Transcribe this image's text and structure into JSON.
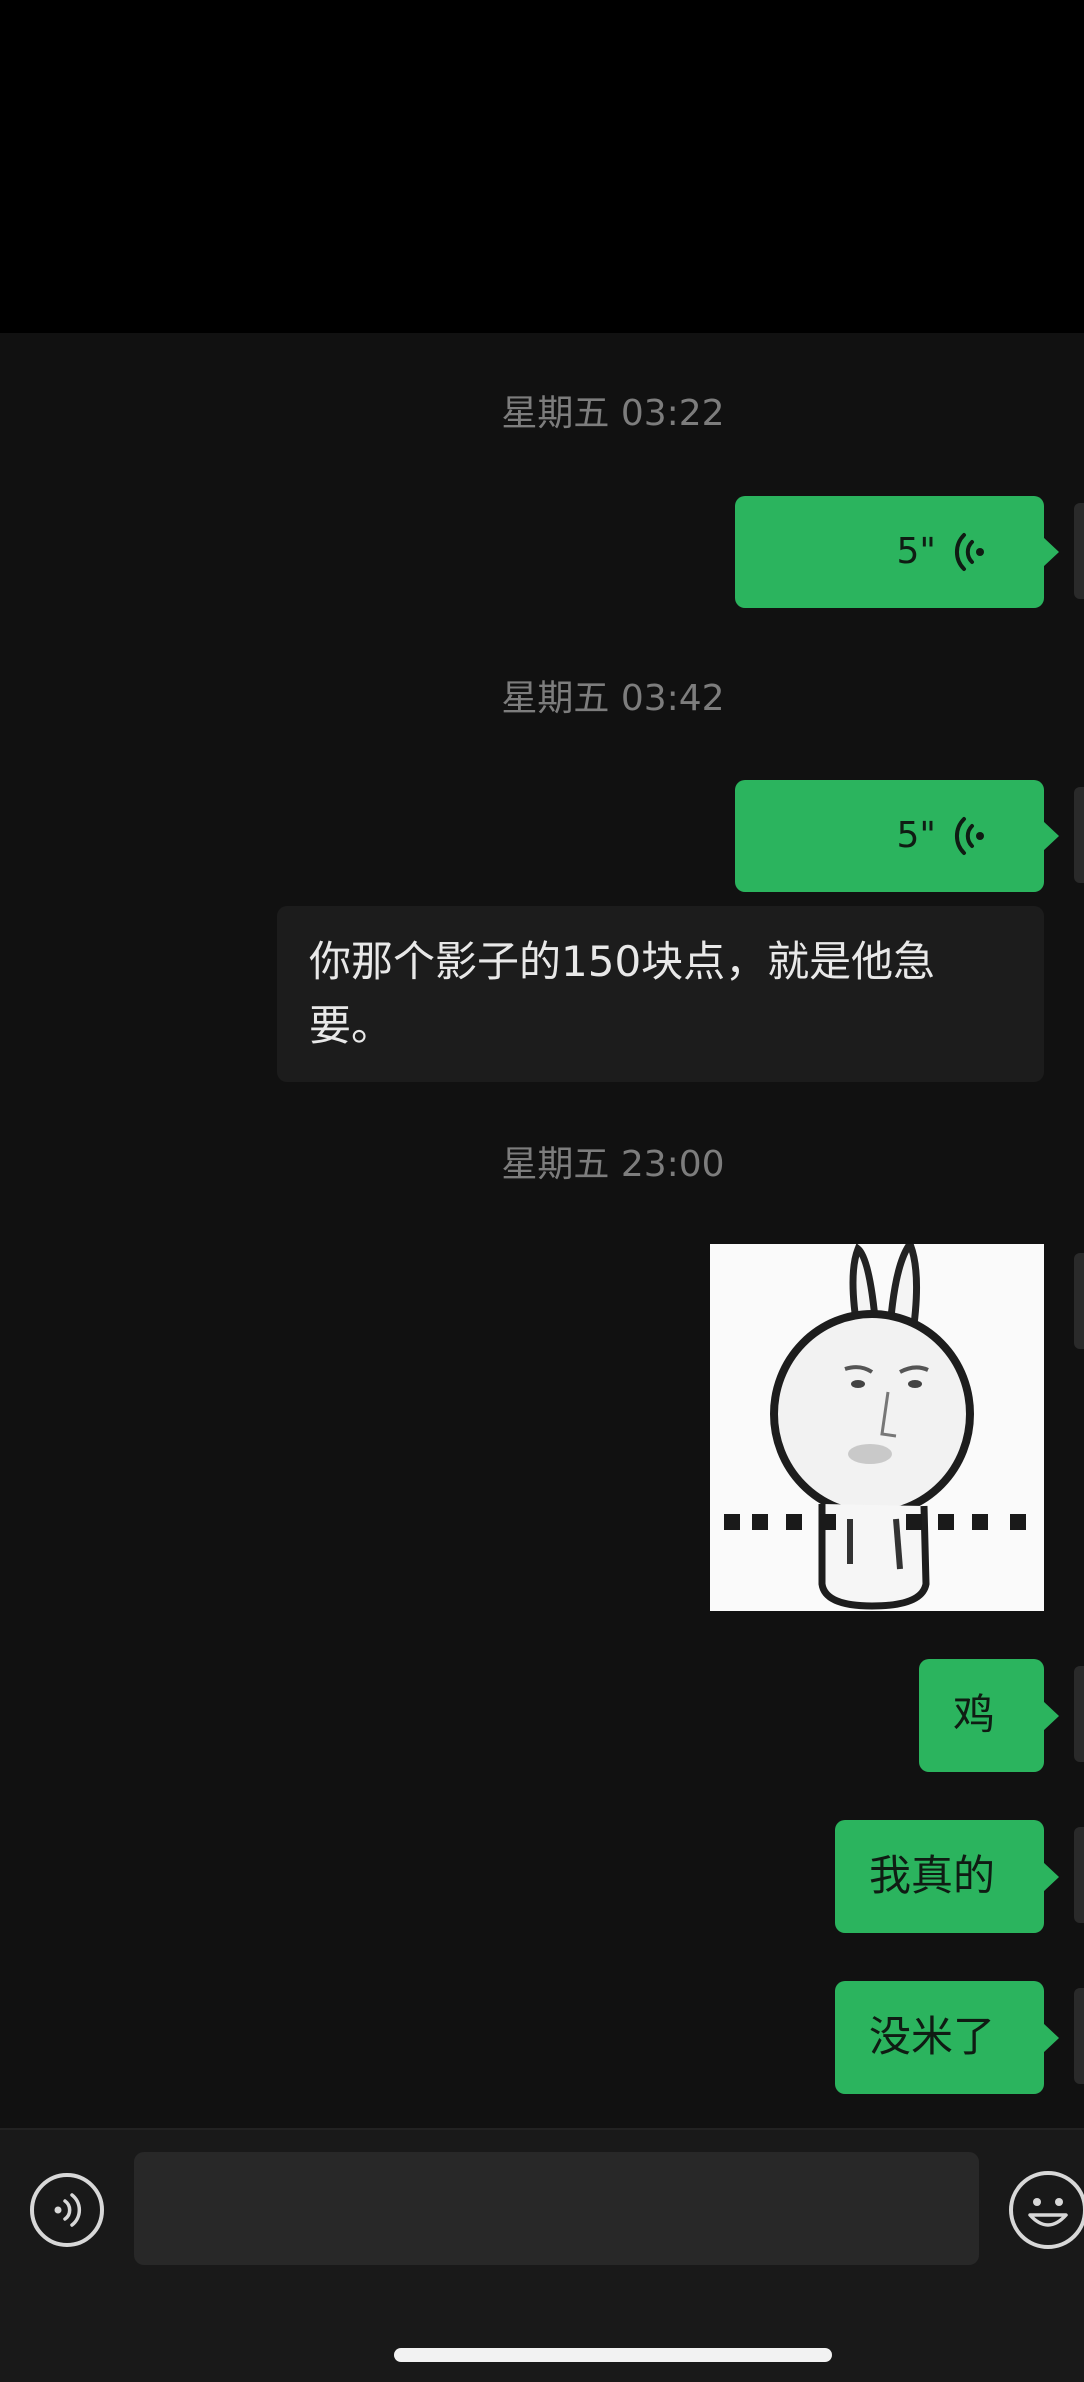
{
  "colors": {
    "sent_bubble": "#2bb45e",
    "received_bubble": "#1c1c1c",
    "chat_background": "#111111",
    "timestamp_text": "#7d7d7d"
  },
  "messages": [
    {
      "type": "timestamp",
      "text": "星期五 03:22"
    },
    {
      "type": "voice",
      "direction": "sent",
      "duration": "5\"",
      "icon": "voice-wave-icon"
    },
    {
      "type": "timestamp",
      "text": "星期五 03:42"
    },
    {
      "type": "voice",
      "direction": "sent",
      "duration": "5\"",
      "icon": "voice-wave-icon"
    },
    {
      "type": "text",
      "direction": "received",
      "text": "你那个影子的150块点，就是他急要。"
    },
    {
      "type": "timestamp",
      "text": "星期五 23:00"
    },
    {
      "type": "sticker",
      "direction": "sent",
      "description": "rabbit-sticker"
    },
    {
      "type": "text",
      "direction": "sent",
      "text": "鸡"
    },
    {
      "type": "text",
      "direction": "sent",
      "text": "我真的"
    },
    {
      "type": "text",
      "direction": "sent",
      "text": "没米了"
    }
  ],
  "input_bar": {
    "voice_icon": "voice-input-icon",
    "input_value": "",
    "emoji_icon": "emoji-icon"
  }
}
